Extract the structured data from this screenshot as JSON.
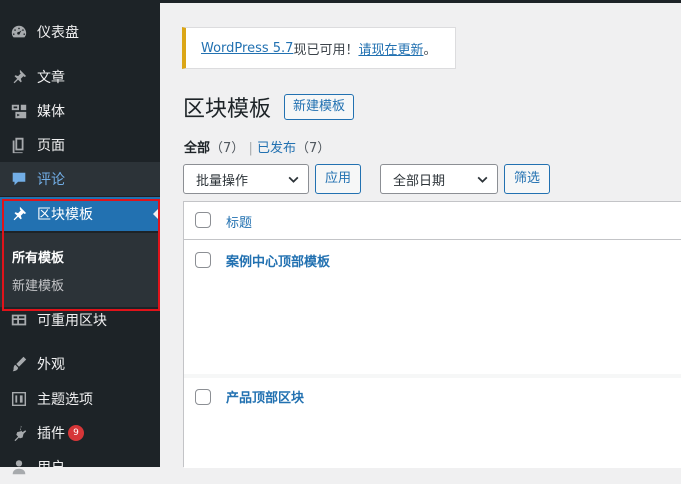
{
  "sidebar": {
    "items": [
      {
        "label": "仪表盘",
        "icon": "dashboard-icon"
      },
      {
        "label": "文章",
        "icon": "pin-icon"
      },
      {
        "label": "媒体",
        "icon": "media-icon"
      },
      {
        "label": "页面",
        "icon": "page-icon"
      },
      {
        "label": "评论",
        "icon": "comment-icon"
      },
      {
        "label": "区块模板",
        "icon": "pin-icon"
      },
      {
        "label": "可重用区块",
        "icon": "table-icon"
      },
      {
        "label": "外观",
        "icon": "brush-icon"
      },
      {
        "label": "主题选项",
        "icon": "theme-options-icon"
      },
      {
        "label": "插件",
        "icon": "plugin-icon",
        "badge": "9"
      },
      {
        "label": "用户",
        "icon": "user-icon"
      }
    ],
    "submenu": [
      {
        "label": "所有模板"
      },
      {
        "label": "新建模板"
      }
    ],
    "highlight_color": "#e0131a"
  },
  "notice": {
    "link1": "WordPress 5.7",
    "text": "现已可用！",
    "link2": "请现在更新",
    "end": "。"
  },
  "page": {
    "title": "区块模板",
    "add_new": "新建模板"
  },
  "filters": {
    "all_label": "全部",
    "all_count": "（7）",
    "sep": "|",
    "published_label": "已发布",
    "published_count": "（7）"
  },
  "toolbar": {
    "bulk_action": "批量操作",
    "apply": "应用",
    "date_filter": "全部日期",
    "filter": "筛选"
  },
  "table": {
    "column_title": "标题",
    "rows": [
      {
        "title": "案例中心顶部模板"
      },
      {
        "title": "产品顶部区块"
      }
    ]
  }
}
